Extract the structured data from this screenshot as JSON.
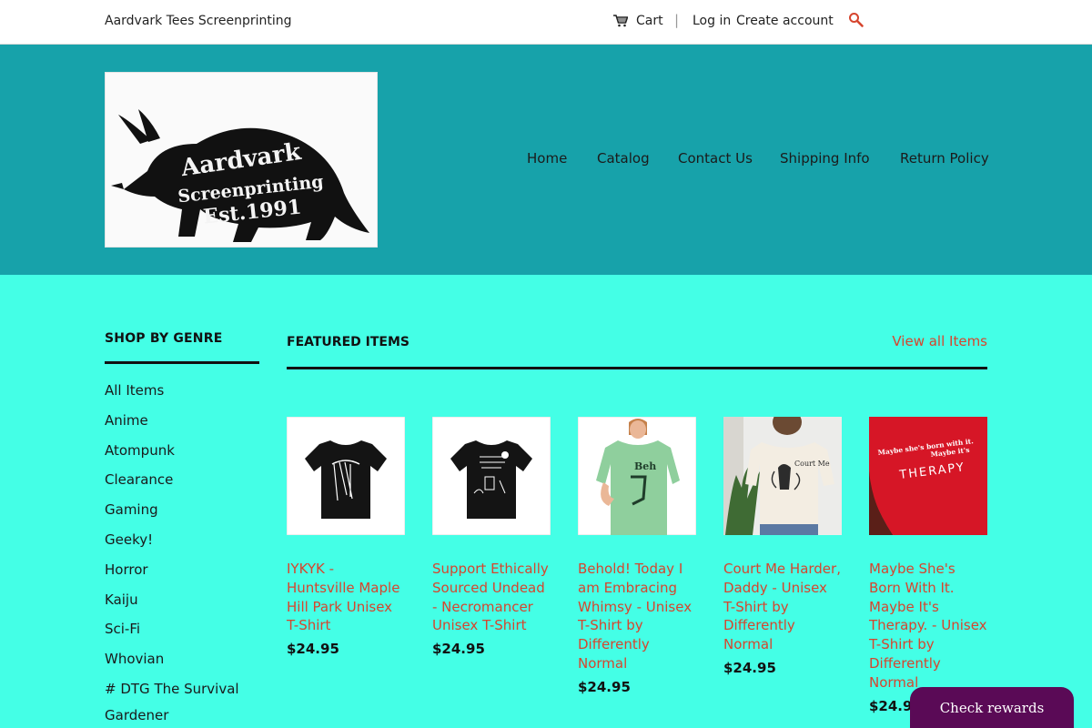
{
  "topbar": {
    "store_name": "Aardvark Tees Screenprinting",
    "cart_label": "Cart",
    "separator": "|",
    "login_label": "Log in",
    "create_account_label": "Create account",
    "search_icon": "search-icon"
  },
  "header": {
    "logo_text": {
      "line1": "Aardvark",
      "line2": "Screenprinting",
      "line3": "Est.1991"
    },
    "nav": [
      "Home",
      "Catalog",
      "Contact Us",
      "Shipping Info",
      "Return Policy"
    ]
  },
  "sidebar": {
    "title": "SHOP BY GENRE",
    "genres": [
      "All Items",
      "Anime",
      "Atompunk",
      "Clearance",
      "Gaming",
      "Geeky!",
      "Horror",
      "Kaiju",
      "Sci-Fi",
      "Whovian",
      "# DTG The Survival Gardener"
    ]
  },
  "featured": {
    "title": "FEATURED ITEMS",
    "view_all": "View all Items",
    "products": [
      {
        "title": "IYKYK - Huntsville Maple Hill Park Unisex T-Shirt",
        "price": "$24.95"
      },
      {
        "title": "Support Ethically Sourced Undead - Necromancer Unisex T-Shirt",
        "price": "$24.95"
      },
      {
        "title": "Behold! Today I am Embracing Whimsy - Unisex T-Shirt by Differently Normal",
        "price": "$24.95"
      },
      {
        "title": "Court Me Harder, Daddy - Unisex T-Shirt by Differently Normal",
        "price": "$24.95"
      },
      {
        "title": "Maybe She's Born With It. Maybe It's Therapy. - Unisex T-Shirt by Differently Normal",
        "price": "$24.95"
      }
    ],
    "product5_print": {
      "line1": "Maybe she's born with it.",
      "line2": "Maybe it's",
      "line3": "THERAPY"
    }
  },
  "rewards": {
    "label": "Check rewards"
  },
  "colors": {
    "page_bg": "#44ffe6",
    "header_bg": "#17a2aa",
    "link": "#d6452e",
    "rewards_bg": "#5a0a56"
  }
}
